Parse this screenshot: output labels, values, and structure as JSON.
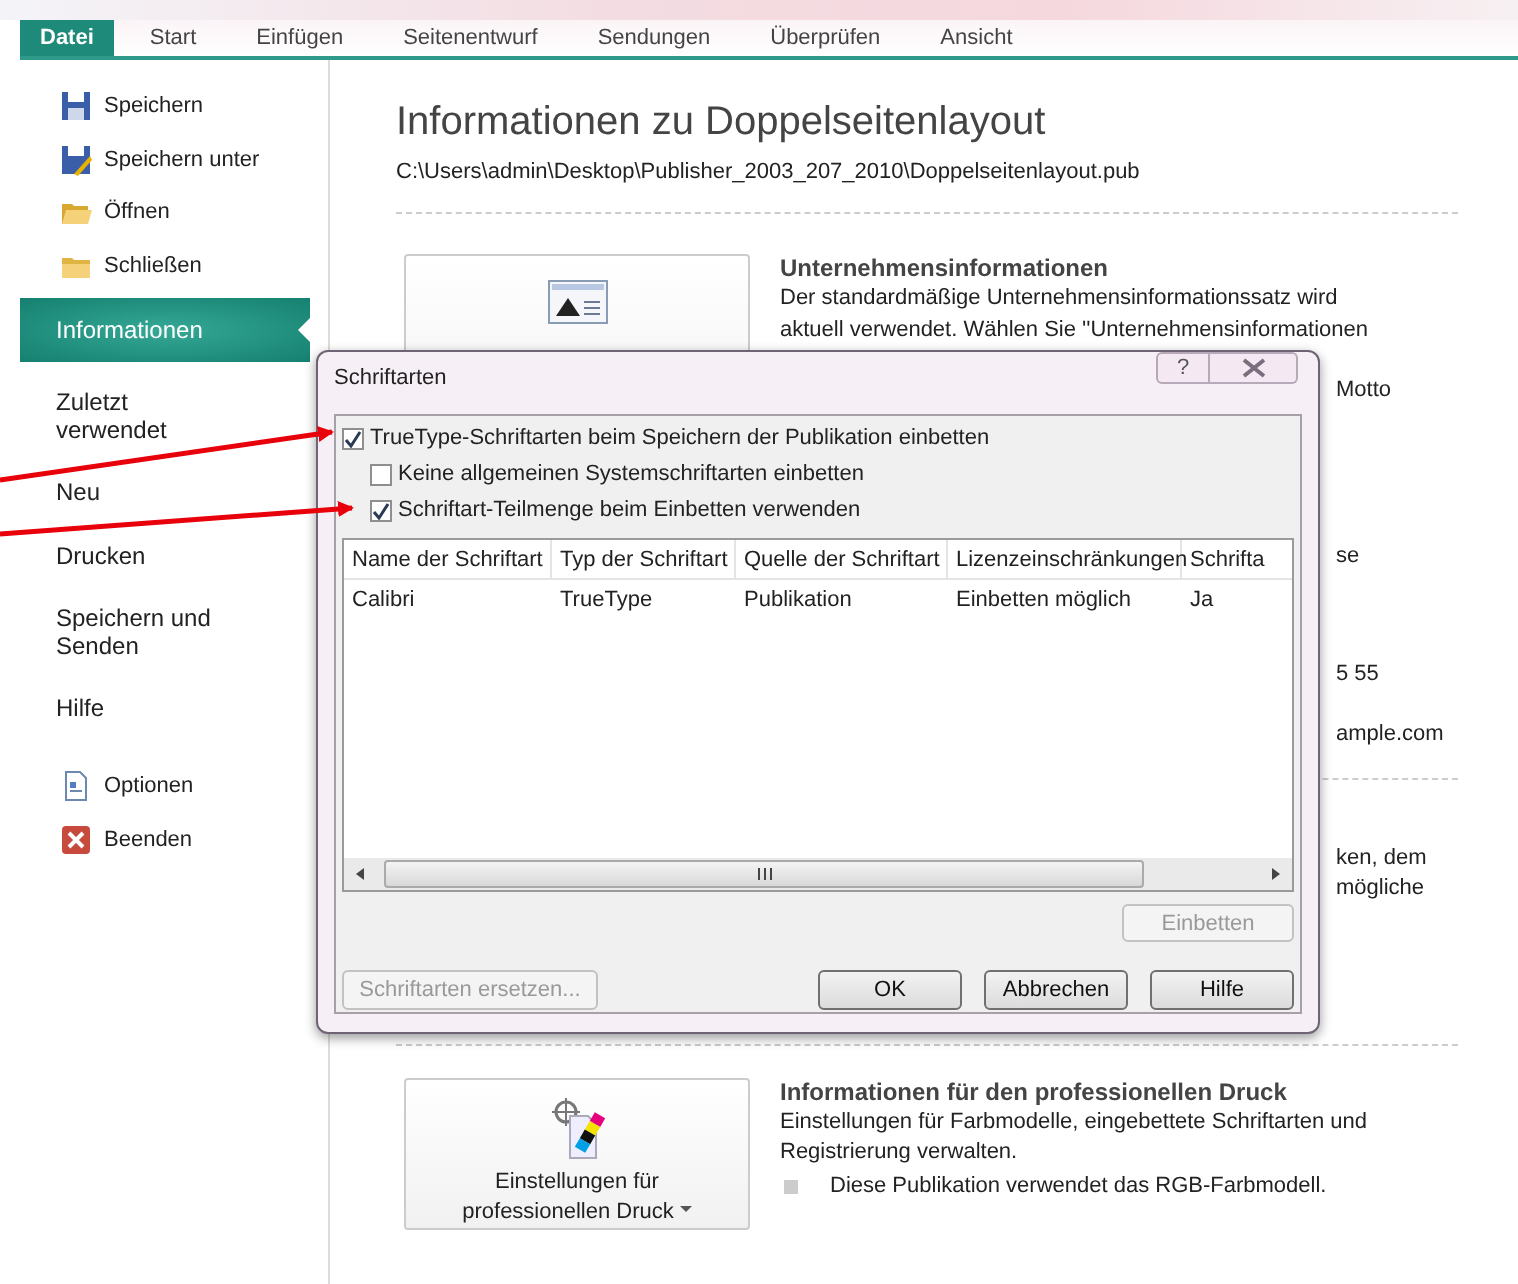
{
  "tabs": [
    {
      "label": "Datei",
      "selected": true
    },
    {
      "label": "Start",
      "selected": false
    },
    {
      "label": "Einfügen",
      "selected": false
    },
    {
      "label": "Seitenentwurf",
      "selected": false
    },
    {
      "label": "Sendungen",
      "selected": false
    },
    {
      "label": "Überprüfen",
      "selected": false
    },
    {
      "label": "Ansicht",
      "selected": false
    }
  ],
  "sidebar": {
    "items": [
      {
        "label": "Speichern",
        "kind": "command",
        "selected": false
      },
      {
        "label": "Speichern unter",
        "kind": "command",
        "selected": false
      },
      {
        "label": "Öffnen",
        "kind": "command",
        "selected": false
      },
      {
        "label": "Schließen",
        "kind": "command",
        "selected": false
      },
      {
        "label": "Informationen",
        "kind": "page",
        "selected": true
      },
      {
        "label": "Zuletzt verwendet",
        "kind": "page",
        "selected": false
      },
      {
        "label": "Neu",
        "kind": "page",
        "selected": false
      },
      {
        "label": "Drucken",
        "kind": "page",
        "selected": false
      },
      {
        "label": "Speichern und Senden",
        "kind": "page",
        "selected": false
      },
      {
        "label": "Hilfe",
        "kind": "page",
        "selected": false
      },
      {
        "label": "Optionen",
        "kind": "command",
        "selected": false
      },
      {
        "label": "Beenden",
        "kind": "command",
        "selected": false
      }
    ]
  },
  "main": {
    "title": "Informationen zu Doppelseitenlayout",
    "path": "C:\\Users\\admin\\Desktop\\Publisher_2003_207_2010\\Doppelseitenlayout.pub",
    "sections": [
      {
        "heading": "Unternehmensinformationen",
        "lines": [
          "Der standardmäßige Unternehmensinformationssatz wird",
          "aktuell verwendet. Wählen Sie ''Unternehmensinformationen"
        ],
        "peek": [
          "Motto",
          "se",
          "5 55",
          "ample.com"
        ]
      },
      {
        "peek": [
          "ken, dem",
          "mögliche"
        ]
      },
      {
        "heading": "Informationen für den professionellen Druck",
        "button": "Einstellungen für professionellen Druck",
        "lines": [
          "Einstellungen für Farbmodelle, eingebettete Schriftarten und Registrierung verwalten."
        ],
        "bullets": [
          "Diese Publikation verwendet das RGB-Farbmodell."
        ]
      }
    ]
  },
  "dialog": {
    "title": "Schriftarten",
    "help": "?",
    "options": [
      {
        "label": "TrueType-Schriftarten beim Speichern der Publikation einbetten",
        "checked": true,
        "children": [
          {
            "label": "Keine allgemeinen Systemschriftarten einbetten",
            "checked": false
          },
          {
            "label": "Schriftart-Teilmenge beim Einbetten verwenden",
            "checked": true
          }
        ]
      }
    ],
    "table": {
      "columns": [
        "Name der Schriftart",
        "Typ der Schriftart",
        "Quelle der Schriftart",
        "Lizenzeinschränkungen",
        "Schrifta"
      ],
      "rows": [
        [
          "Calibri",
          "TrueType",
          "Publikation",
          "Einbetten möglich",
          "Ja"
        ]
      ]
    },
    "embed_button": {
      "label": "Einbetten",
      "disabled": true
    },
    "buttons": [
      {
        "label": "Schriftarten ersetzen...",
        "disabled": true
      },
      {
        "label": "OK",
        "disabled": false
      },
      {
        "label": "Abbrechen",
        "disabled": false
      },
      {
        "label": "Hilfe",
        "disabled": false
      }
    ]
  }
}
